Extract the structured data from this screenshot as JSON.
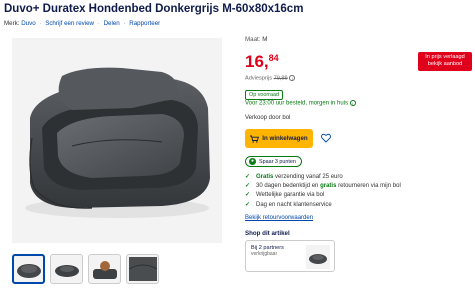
{
  "product": {
    "title": "Duvo+ Duratex Hondenbed Donkergrijs M-60x80x16cm",
    "brand_label": "Merk:",
    "brand": "Duvo",
    "links": [
      "Schrijf een review",
      "Delen",
      "Rapporteer"
    ],
    "size_label": "Maat:",
    "size_value": "M"
  },
  "pricing": {
    "price_whole": "16,",
    "price_cents": "84",
    "badge_line1": "In prijs verlaagd",
    "badge_line2": "bekijk aanbod",
    "advice_label": "Adviesprijs",
    "advice_price": "79,99"
  },
  "availability": {
    "stock": "Op voorraad",
    "delivery": "Voor 23:00 uur besteld, morgen in huis",
    "seller": "Verkoop door bol"
  },
  "actions": {
    "cart_label": "In winkelwagen"
  },
  "points": {
    "label": "Spaar 3 punten"
  },
  "usps": [
    {
      "bold": "Gratis",
      "rest": " verzending vanaf 25 euro"
    },
    {
      "pre": "30 dagen bedenktijd en ",
      "bold": "gratis",
      "rest": " retourneren via mijn bol"
    },
    {
      "rest": "Wettelijke garantie via bol"
    },
    {
      "rest": "Dag en nacht klantenservice"
    }
  ],
  "return_link": "Bekijk retourvoorwaarden",
  "shop": {
    "title": "Shop dit artikel",
    "partner_line1": "Bij 2 partners",
    "partner_line2": "verkrijgbaar"
  },
  "colors": {
    "price_red": "#e0001b",
    "cart_yellow": "#ffb400",
    "green": "#0a7a14",
    "link_blue": "#0047ab",
    "navy": "#0f1b4c"
  }
}
